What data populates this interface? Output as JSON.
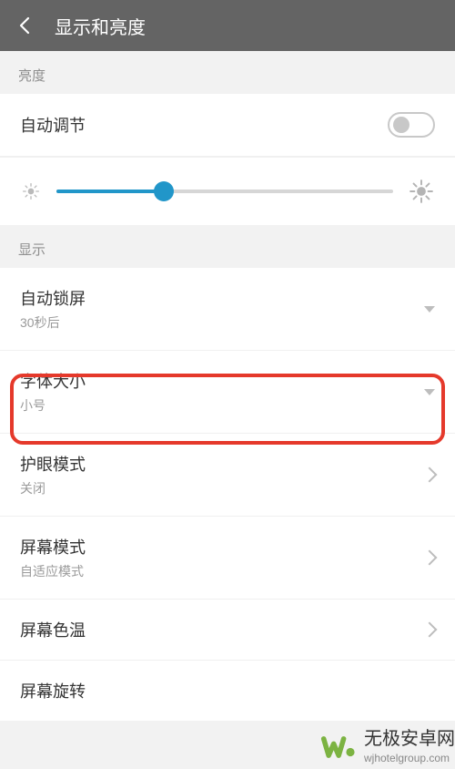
{
  "header": {
    "title": "显示和亮度"
  },
  "sections": {
    "brightness": "亮度",
    "display": "显示"
  },
  "brightness": {
    "autoAdjust": {
      "label": "自动调节",
      "on": false
    },
    "slider": {
      "percent": 32
    }
  },
  "display": {
    "autoLock": {
      "label": "自动锁屏",
      "value": "30秒后"
    },
    "fontSize": {
      "label": "字体大小",
      "value": "小号"
    },
    "eyeCare": {
      "label": "护眼模式",
      "value": "关闭"
    },
    "screenMode": {
      "label": "屏幕模式",
      "value": "自适应模式"
    },
    "colorTemp": {
      "label": "屏幕色温"
    },
    "rotation": {
      "label": "屏幕旋转"
    }
  },
  "watermark": {
    "cn": "无极安卓网",
    "url": "wjhotelgroup.com"
  },
  "colors": {
    "accent": "#2196c9",
    "highlight": "#e5392b",
    "wmGreen": "#7cb342"
  }
}
